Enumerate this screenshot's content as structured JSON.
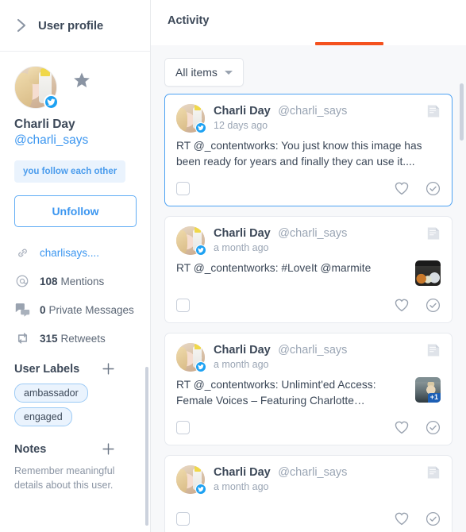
{
  "sidebar": {
    "header": {
      "title": "User profile",
      "back_icon": "chevron-right-icon"
    },
    "profile": {
      "name": "Charli Day",
      "handle": "@charli_says",
      "avatar_alt": "Charli Day avatar",
      "verified_badge": "twitter-verified-icon",
      "favorite_icon": "star-icon",
      "relationship_badge": "you follow each other",
      "follow_button": "Unfollow"
    },
    "stats": [
      {
        "icon": "link-icon",
        "value": "",
        "label": "charlisays....",
        "is_link": true
      },
      {
        "icon": "at-icon",
        "value": "108",
        "label": "Mentions",
        "is_link": false
      },
      {
        "icon": "messages-icon",
        "value": "0",
        "label": "Private Messages",
        "is_link": false
      },
      {
        "icon": "retweet-icon",
        "value": "315",
        "label": "Retweets",
        "is_link": false
      }
    ],
    "labels_section": {
      "title": "User Labels",
      "add_icon": "plus-icon",
      "chips": [
        "ambassador",
        "engaged"
      ]
    },
    "notes_section": {
      "title": "Notes",
      "add_icon": "plus-icon",
      "placeholder": "Remember meaningful details about this user."
    }
  },
  "main": {
    "tabs": [
      {
        "label": "Activity",
        "active": true
      }
    ],
    "filter": {
      "label": "All items",
      "caret_icon": "chevron-down-icon"
    },
    "cards": [
      {
        "name": "Charli Day",
        "handle": "@charli_says",
        "time": "12 days ago",
        "text": "RT @_contentworks: You just know this image has been ready for years and finally they can use it....",
        "note_icon": "note-icon",
        "thumb": null,
        "thumb_badge": null,
        "selected": true,
        "like_icon": "heart-icon",
        "done_icon": "check-circle-icon",
        "checkbox": "select-checkbox"
      },
      {
        "name": "Charli Day",
        "handle": "@charli_says",
        "time": "a month ago",
        "text": "RT @_contentworks: #LoveIt @marmite",
        "note_icon": "note-icon",
        "thumb": "marmite",
        "thumb_badge": null,
        "selected": false,
        "like_icon": "heart-icon",
        "done_icon": "check-circle-icon",
        "checkbox": "select-checkbox"
      },
      {
        "name": "Charli Day",
        "handle": "@charli_says",
        "time": "a month ago",
        "text": "RT @_contentworks: Unlimint'ed Access: Female Voices – Featuring Charlotte…",
        "note_icon": "note-icon",
        "thumb": "video",
        "thumb_badge": "+1",
        "selected": false,
        "like_icon": "heart-icon",
        "done_icon": "check-circle-icon",
        "checkbox": "select-checkbox"
      },
      {
        "name": "Charli Day",
        "handle": "@charli_says",
        "time": "a month ago",
        "text": "",
        "note_icon": "note-icon",
        "thumb": null,
        "thumb_badge": null,
        "selected": false,
        "like_icon": "heart-icon",
        "done_icon": "check-circle-icon",
        "checkbox": "select-checkbox"
      }
    ]
  },
  "colors": {
    "accent_orange": "#f4511e",
    "link_blue": "#3b96f0",
    "twitter_blue": "#1da1f2",
    "text_dark": "#3c4858",
    "muted": "#9aa5b4",
    "selected_border": "#4ea2f3",
    "chip_bg": "#eaf3fd"
  }
}
